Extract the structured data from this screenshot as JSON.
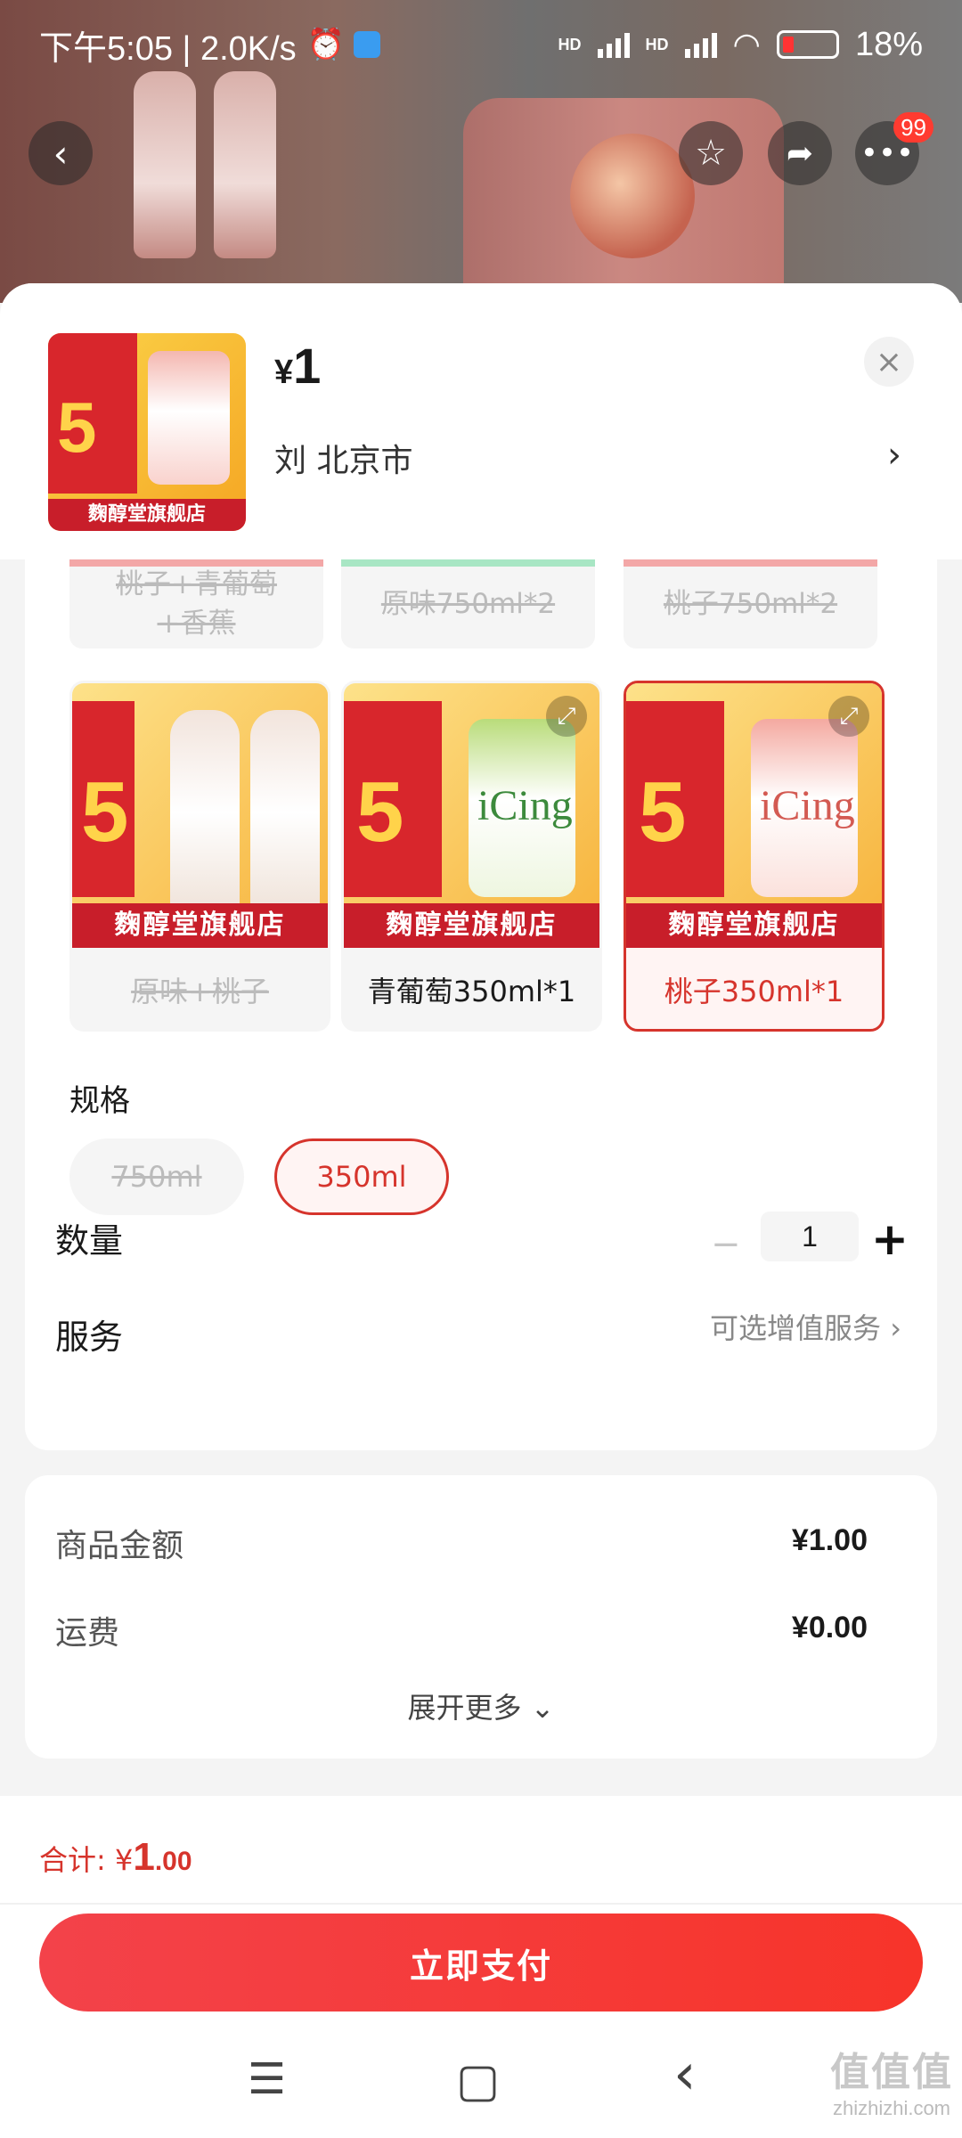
{
  "status_bar": {
    "time": "下午5:05 | 2.0K/s",
    "hd1": "HD",
    "hd2": "HD",
    "battery": "18%"
  },
  "header": {
    "more_badge": "99"
  },
  "sheet": {
    "price_symbol": "¥",
    "price": "1",
    "address": "刘  北京市",
    "close_icon": "×",
    "address_arrow": "›"
  },
  "options": {
    "top_row": [
      "桃子+青葡萄+香蕉",
      "原味750ml*2",
      "桃子750ml*2"
    ],
    "cards": [
      {
        "label": "原味+桃子",
        "band": "麴醇堂旗舰店",
        "state": "disabled"
      },
      {
        "label": "青葡萄350ml*1",
        "band": "麴醇堂旗舰店",
        "state": "normal",
        "can_text": "iCing"
      },
      {
        "label": "桃子350ml*1",
        "band": "麴醇堂旗舰店",
        "state": "selected",
        "can_text": "iCing"
      }
    ]
  },
  "spec": {
    "title": "规格",
    "chips": [
      "750ml",
      "350ml"
    ]
  },
  "quantity": {
    "title": "数量",
    "minus": "−",
    "value": "1",
    "plus": "+"
  },
  "service": {
    "title": "服务",
    "hint": "可选增值服务 ›"
  },
  "cost": {
    "goods_label": "商品金额",
    "goods_value": "¥1.00",
    "ship_label": "运费",
    "ship_value": "¥0.00",
    "expand": "展开更多 ⌄"
  },
  "footer": {
    "total_label": "合计: ¥",
    "total_int": "1",
    "total_dec": ".00",
    "pay_button": "立即支付"
  },
  "nav_bar": {
    "menu": "☰",
    "home": "▢",
    "back": "‹"
  },
  "watermark": {
    "big": "值值值",
    "small": "zhizhizhi.com"
  },
  "colors": {
    "accent": "#d6342c",
    "pay_gradient_start": "#f3424a",
    "pay_gradient_end": "#f7342a"
  }
}
